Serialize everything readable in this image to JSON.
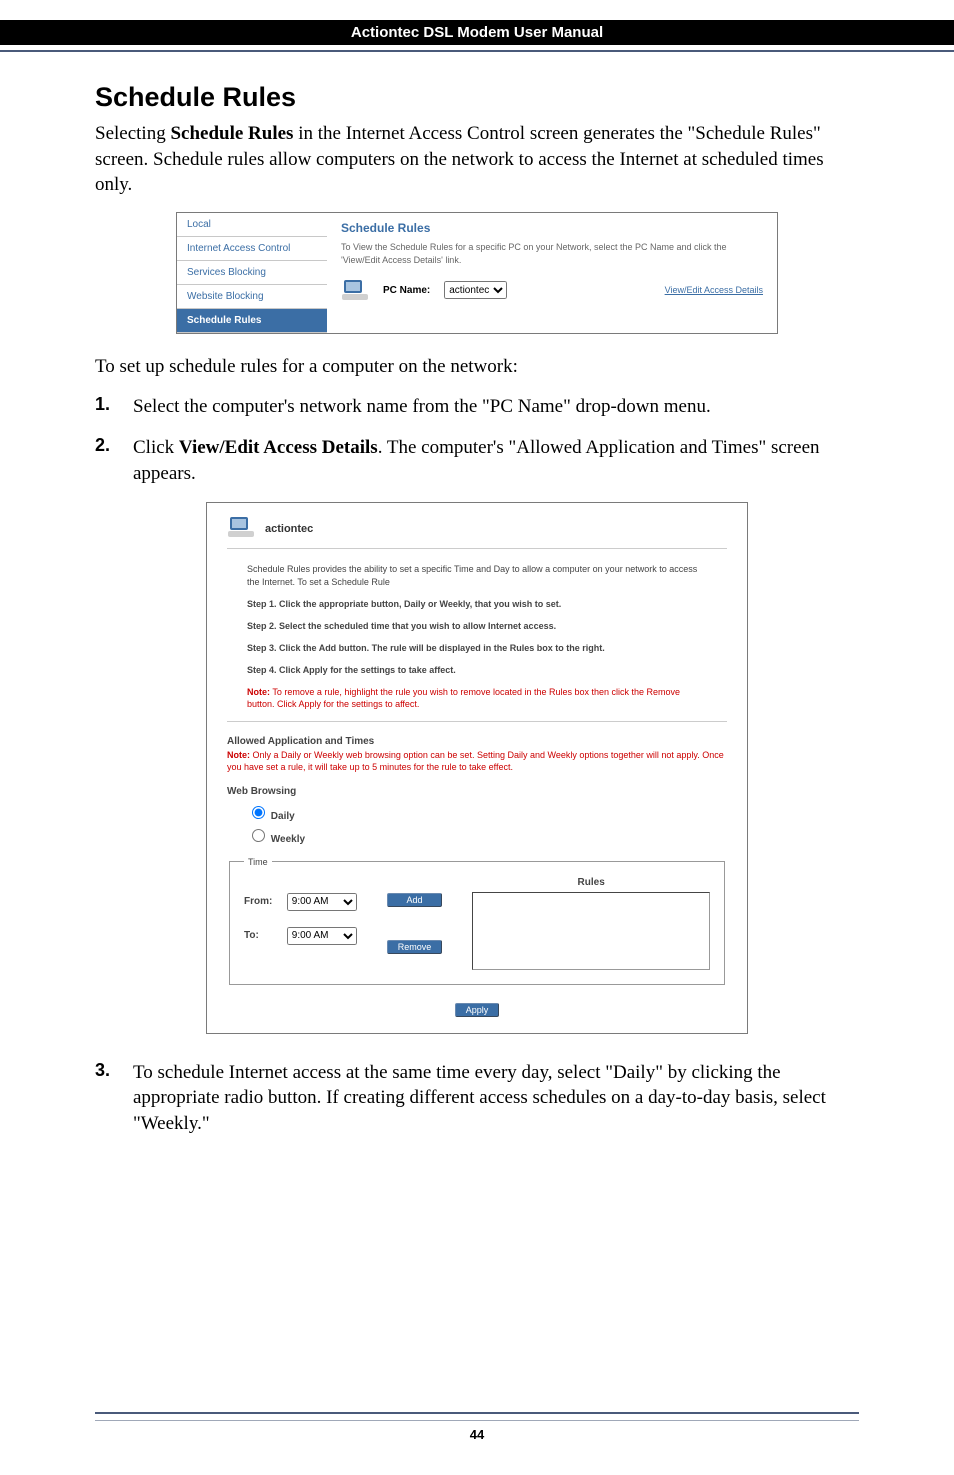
{
  "header": {
    "title": "Actiontec DSL Modem User Manual"
  },
  "section": {
    "heading": "Schedule Rules"
  },
  "intro": {
    "p1_a": "Selecting ",
    "p1_b": "Schedule Rules",
    "p1_c": " in the Internet Access Control screen generates the \"Schedule Rules\" screen. Schedule rules allow computers on the network to access the Internet at scheduled times only."
  },
  "fig1": {
    "nav": {
      "local": "Local",
      "iac": "Internet Access Control",
      "svc": "Services Blocking",
      "web": "Website Blocking",
      "sched": "Schedule Rules"
    },
    "title": "Schedule Rules",
    "desc": "To View the Schedule Rules for a specific PC on your Network, select the PC Name and click the 'View/Edit Access Details' link.",
    "pcname_label": "PC Name:",
    "pcname_value": "actiontec",
    "link": "View/Edit Access Details"
  },
  "after_fig1": "To set up schedule rules for a computer on the network:",
  "steps": {
    "s1_a": "Select the computer's network name from the \"PC Name\" drop-down menu.",
    "s2_a": "Click ",
    "s2_b": "View/Edit Access Details",
    "s2_c": ". The computer's \"Allowed Application and Times\" screen appears.",
    "s3_a": "To schedule Internet access at the same time every day, select \"Daily\" by clicking the appropriate radio button. If creating different access schedules on a day-to-day basis, select \"Weekly.\""
  },
  "fig2": {
    "brand": "actiontec",
    "intro": "Schedule Rules provides the ability to set a specific Time and Day to allow a computer on your network to access the Internet. To set a Schedule Rule",
    "step1": "Step 1. Click the appropriate button, Daily or Weekly, that you wish to set.",
    "step2": "Step 2. Select the scheduled time that you wish to allow Internet access.",
    "step3": "Step 3. Click the Add button. The rule will be displayed in the Rules box to the right.",
    "step4": "Step 4. Click Apply for the settings to take affect.",
    "note1_label": "Note:",
    "note1_text": " To remove a rule, highlight the rule you wish to remove located in the Rules box then click the Remove button. Click Apply for the settings to affect.",
    "allowed_heading": "Allowed Application and Times",
    "note2_label": "Note:",
    "note2_text": " Only a Daily or Weekly web browsing option can be set. Setting Daily and Weekly options together will not apply. Once you have set a rule, it will take up to 5 minutes for the rule to take effect.",
    "web_browsing": "Web Browsing",
    "daily": "Daily",
    "weekly": "Weekly",
    "time_legend": "Time",
    "from_label": "From:",
    "from_value": "9:00 AM",
    "to_label": "To:",
    "to_value": "9:00 AM",
    "add_btn": "Add",
    "remove_btn": "Remove",
    "rules_label": "Rules",
    "apply_btn": "Apply"
  },
  "page_number": "44"
}
